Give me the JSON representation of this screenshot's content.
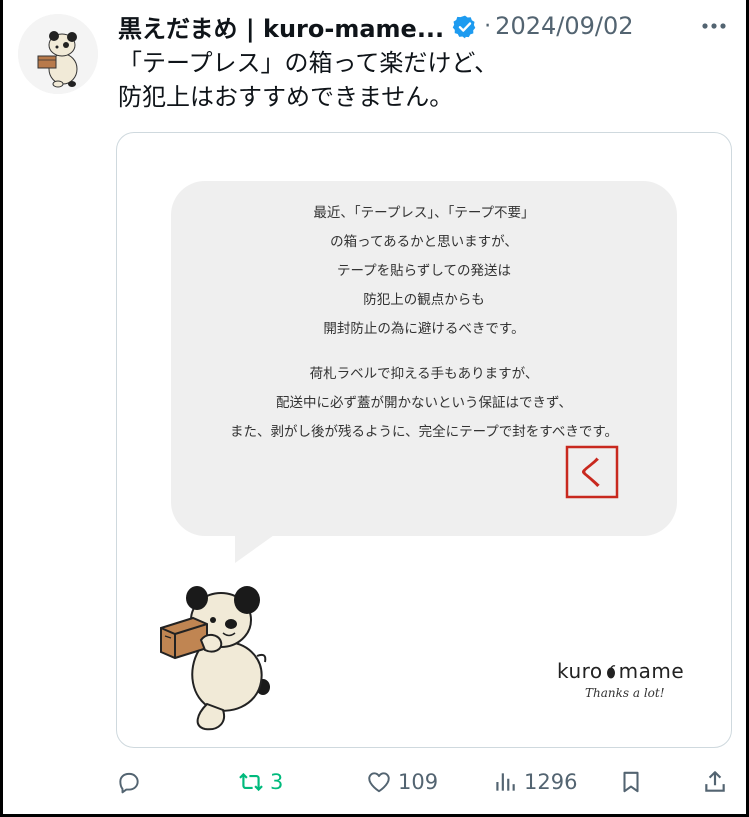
{
  "tweet": {
    "display_name": "黒えだまめ | kuro-mame...",
    "separator": "·",
    "date": "2024/09/02",
    "text_lines": [
      "「テープレス」の箱って楽だけど、",
      "防犯上はおすすめできません。"
    ]
  },
  "card": {
    "bubble_lines_1": [
      "最近、「テープレス」、「テープ不要」",
      "の箱ってあるかと思いますが、",
      "テープを貼らずしての発送は",
      "防犯上の観点からも",
      "開封防止の為に避けるべきです。"
    ],
    "bubble_lines_2": [
      "荷札ラベルで抑える手もありますが、",
      "配送中に必ず蓋が開かないという保証はできず、",
      "また、剥がし後が残るように、完全にテープで封をすべきです。"
    ],
    "stamp_char": "く",
    "brand_left": "kuro",
    "brand_right": "mame",
    "brand_tagline": "Thanks a lot!"
  },
  "actions": {
    "reply_count": "",
    "retweet_count": "3",
    "like_count": "109",
    "views_count": "1296"
  },
  "icons": {
    "verified": "verified-badge-icon",
    "more": "more-icon",
    "reply": "reply-icon",
    "retweet": "retweet-icon",
    "like": "heart-icon",
    "views": "views-icon",
    "bookmark": "bookmark-icon",
    "share": "share-icon"
  },
  "colors": {
    "verified": "#1d9bf0",
    "muted": "#536471",
    "retweet_green": "#00ba7c",
    "stamp_red": "#c8281e"
  }
}
